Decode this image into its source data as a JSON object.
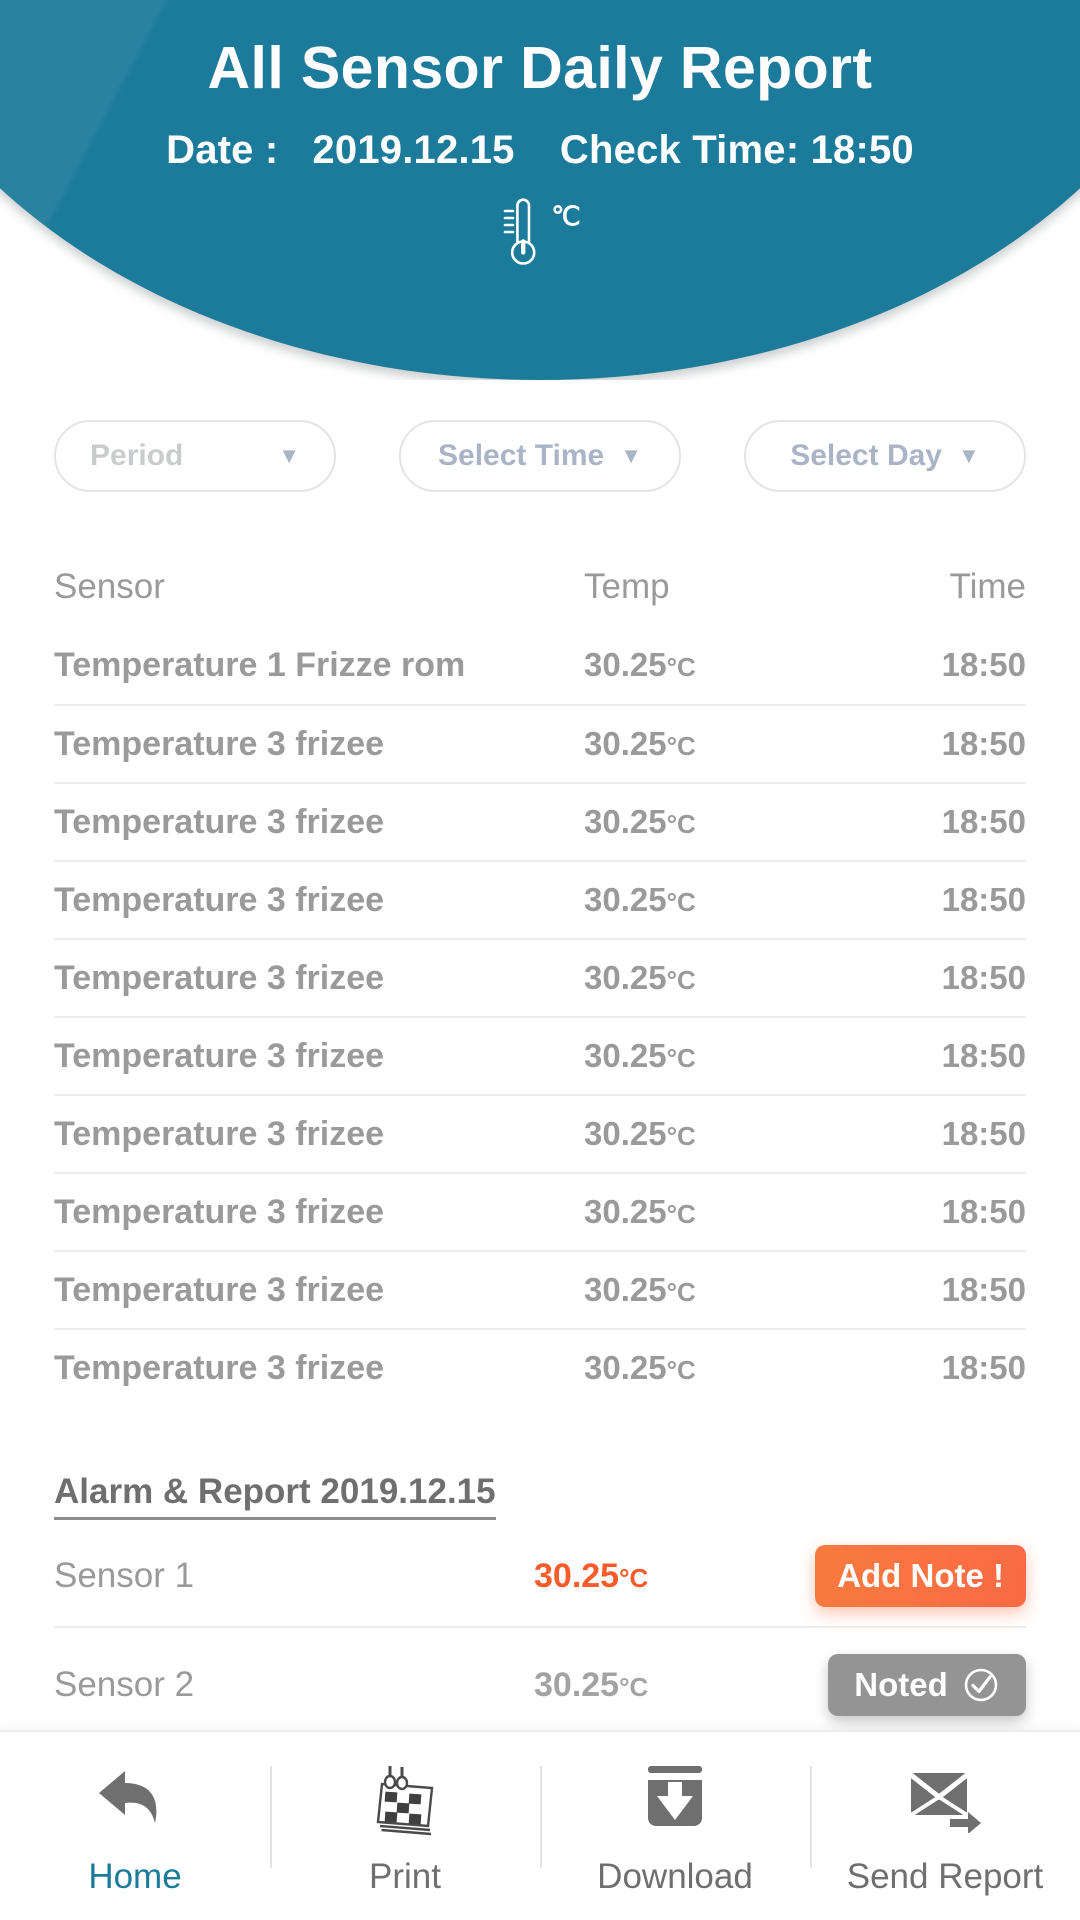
{
  "header": {
    "title": "All Sensor Daily Report",
    "date_label": "Date :",
    "date_value": "2019.12.15",
    "check_time_label": "Check Time:",
    "check_time_value": "18:50",
    "unit_symbol": "℃",
    "bg_color": "#1c7b9b"
  },
  "filters": [
    {
      "label": "Period",
      "caret": "▼"
    },
    {
      "label": "Select Time",
      "caret": "▼"
    },
    {
      "label": "Select Day",
      "caret": "▼"
    }
  ],
  "table": {
    "columns": {
      "sensor": "Sensor",
      "temp": "Temp",
      "time": "Time"
    },
    "rows": [
      {
        "sensor": "Temperature 1 Frizze rom",
        "temp": "30.25",
        "unit": "°C",
        "time": "18:50"
      },
      {
        "sensor": "Temperature 3 frizee",
        "temp": "30.25",
        "unit": "°C",
        "time": "18:50"
      },
      {
        "sensor": "Temperature 3 frizee",
        "temp": "30.25",
        "unit": "°C",
        "time": "18:50"
      },
      {
        "sensor": "Temperature 3 frizee",
        "temp": "30.25",
        "unit": "°C",
        "time": "18:50"
      },
      {
        "sensor": "Temperature 3 frizee",
        "temp": "30.25",
        "unit": "°C",
        "time": "18:50"
      },
      {
        "sensor": "Temperature 3 frizee",
        "temp": "30.25",
        "unit": "°C",
        "time": "18:50"
      },
      {
        "sensor": "Temperature 3 frizee",
        "temp": "30.25",
        "unit": "°C",
        "time": "18:50"
      },
      {
        "sensor": "Temperature 3 frizee",
        "temp": "30.25",
        "unit": "°C",
        "time": "18:50"
      },
      {
        "sensor": "Temperature 3 frizee",
        "temp": "30.25",
        "unit": "°C",
        "time": "18:50"
      },
      {
        "sensor": "Temperature 3 frizee",
        "temp": "30.25",
        "unit": "°C",
        "time": "18:50"
      }
    ]
  },
  "alarm": {
    "title": "Alarm & Report  2019.12.15",
    "rows": [
      {
        "sensor": "Sensor 1",
        "temp": "30.25",
        "unit": "°C",
        "state": "alarm",
        "button_label": "Add Note !",
        "temp_color": "#fa5b2a"
      },
      {
        "sensor": "Sensor 2",
        "temp": "30.25",
        "unit": "°C",
        "state": "noted",
        "button_label": "Noted",
        "temp_color": "#a3a3a3"
      }
    ]
  },
  "bottom_nav": {
    "active_color": "#1c7b9b",
    "items": [
      {
        "label": "Home",
        "icon": "back-arrow-icon"
      },
      {
        "label": "Print",
        "icon": "calendar-pad-icon"
      },
      {
        "label": "Download",
        "icon": "download-icon"
      },
      {
        "label": "Send Report",
        "icon": "send-mail-icon"
      }
    ]
  }
}
